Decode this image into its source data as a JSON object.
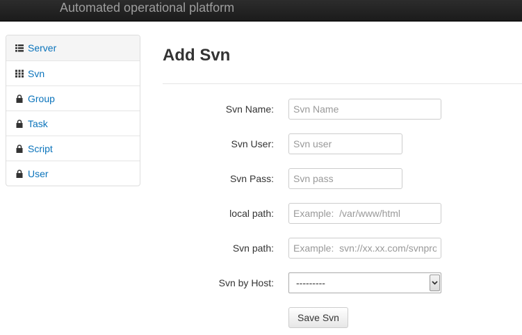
{
  "navbar": {
    "brand": "Automated operational platform"
  },
  "sidebar": {
    "items": [
      {
        "label": "Server",
        "icon": "list-icon"
      },
      {
        "label": "Svn",
        "icon": "grid-icon"
      },
      {
        "label": "Group",
        "icon": "lock-icon"
      },
      {
        "label": "Task",
        "icon": "lock-icon"
      },
      {
        "label": "Script",
        "icon": "lock-icon"
      },
      {
        "label": "User",
        "icon": "lock-icon"
      }
    ]
  },
  "form": {
    "title": "Add Svn",
    "fields": {
      "svn_name": {
        "label": "Svn Name:",
        "placeholder": "Svn Name"
      },
      "svn_user": {
        "label": "Svn User:",
        "placeholder": "Svn user"
      },
      "svn_pass": {
        "label": "Svn Pass:",
        "placeholder": "Svn pass"
      },
      "local_path": {
        "label": "local path:",
        "placeholder": "Example:  /var/www/html"
      },
      "svn_path": {
        "label": "Svn path:",
        "placeholder": "Example:  svn://xx.xx.com/svnproj"
      },
      "svn_host": {
        "label": "Svn by Host:",
        "selected": "---------"
      }
    },
    "save_label": "Save Svn"
  },
  "colors": {
    "link": "#0a73bb",
    "navbar": "#222222",
    "brand_text": "#9d9d9d"
  }
}
